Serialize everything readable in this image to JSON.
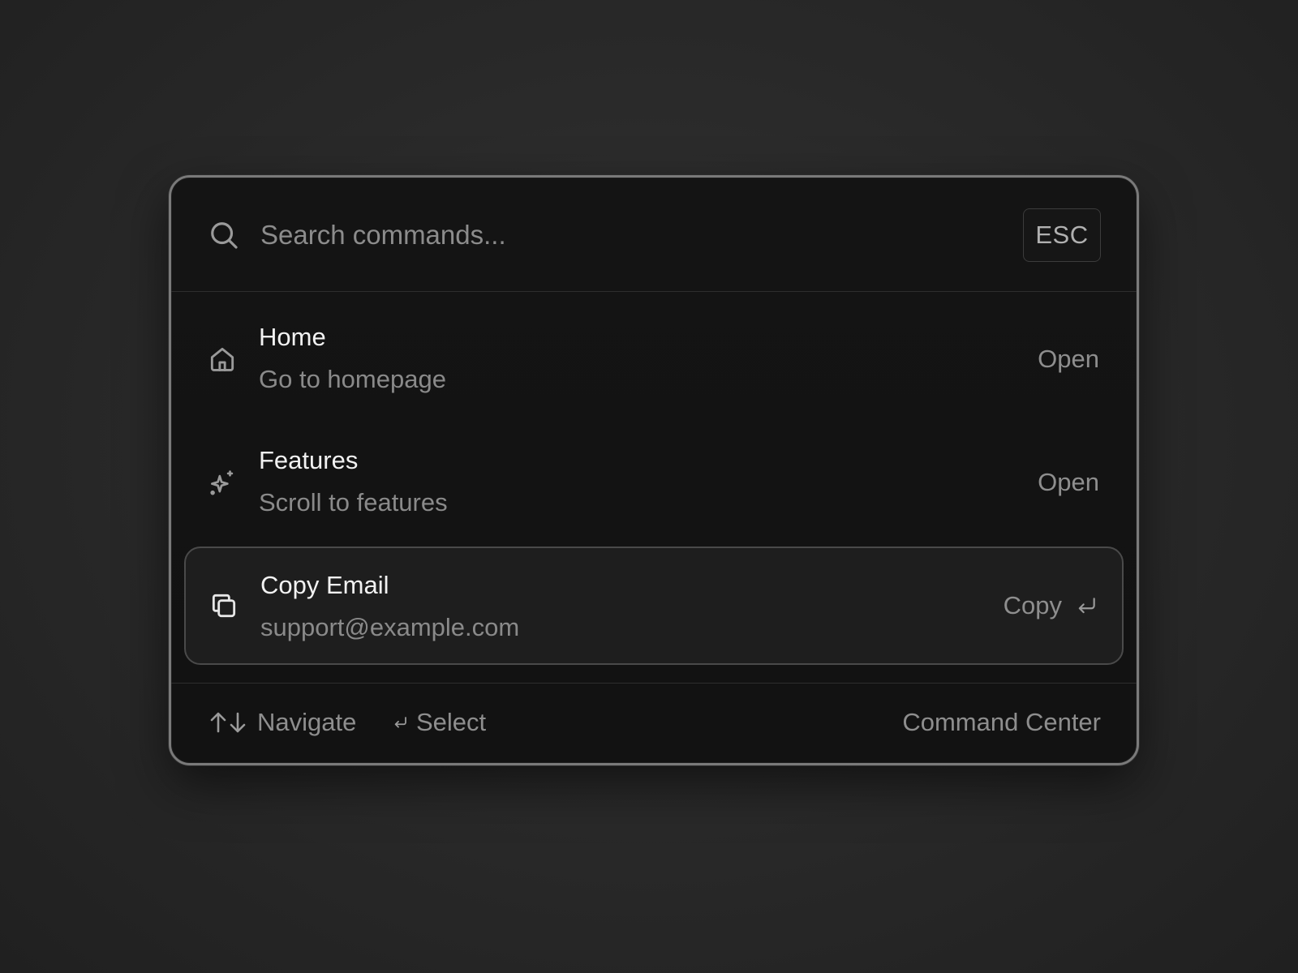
{
  "search": {
    "placeholder": "Search commands...",
    "value": "",
    "icon": "search-icon"
  },
  "esc_key": {
    "label": "ESC"
  },
  "items": [
    {
      "icon": "home-icon",
      "title": "Home",
      "subtitle": "Go to homepage",
      "action": "Open",
      "selected": false
    },
    {
      "icon": "sparkles-icon",
      "title": "Features",
      "subtitle": "Scroll to features",
      "action": "Open",
      "selected": false
    },
    {
      "icon": "copy-icon",
      "title": "Copy Email",
      "subtitle": "support@example.com",
      "action": "Copy",
      "selected": true
    }
  ],
  "footer": {
    "navigate_label": "Navigate",
    "select_label": "Select",
    "title": "Command Center"
  },
  "colors": {
    "background": "#2a2a2a",
    "panel": "#141414",
    "border": "#7a7a7a",
    "selected_row": "#1e1e1e",
    "primary_text": "#f2f2f2",
    "secondary_text": "#8a8a8a"
  }
}
